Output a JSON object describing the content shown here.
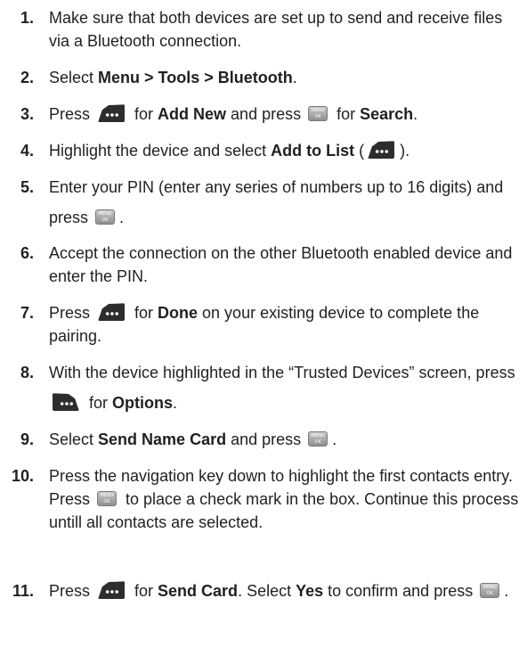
{
  "steps": [
    {
      "num": "1.",
      "parts": [
        "Make sure that both devices are set up to send and receive files via a Bluetooth connection."
      ]
    },
    {
      "num": "2.",
      "parts": [
        "Select ",
        "Menu > Tools > Bluetooth",
        "."
      ]
    },
    {
      "num": "3.",
      "parts": [
        "Press ",
        " for ",
        "Add New",
        " and press ",
        " for ",
        "Search",
        "."
      ]
    },
    {
      "num": "4.",
      "parts": [
        "Highlight the device and select ",
        "Add to List",
        " (",
        ")."
      ]
    },
    {
      "num": "5.",
      "parts": [
        "Enter your PIN (enter any series of numbers up to 16 digits) and press ",
        "."
      ]
    },
    {
      "num": "6.",
      "parts": [
        "Accept the connection on the other Bluetooth enabled device and enter the PIN."
      ]
    },
    {
      "num": "7.",
      "parts": [
        "Press ",
        " for ",
        "Done",
        " on your existing device to complete the pairing."
      ]
    },
    {
      "num": "8.",
      "parts": [
        "With the device highlighted in the “Trusted Devices” screen, press ",
        " for ",
        "Options",
        "."
      ]
    },
    {
      "num": "9.",
      "parts": [
        "Select ",
        "Send Name Card",
        " and press ",
        "."
      ]
    },
    {
      "num": "10.",
      "parts": [
        "Press the navigation key down to highlight the first contacts entry. Press ",
        " to place a check mark in the box. Continue this process untill all contacts are selected."
      ]
    },
    {
      "num": "11.",
      "parts": [
        "Press ",
        " for ",
        "Send Card",
        ". Select ",
        "Yes",
        " to confirm and press ",
        "."
      ]
    }
  ],
  "icons": {
    "left_softkey": "left-softkey-icon",
    "right_softkey": "right-softkey-icon",
    "menu_ok": "menu-ok-key-icon",
    "menu_ok_label_top": "MENU",
    "menu_ok_label_bottom": "OK"
  }
}
